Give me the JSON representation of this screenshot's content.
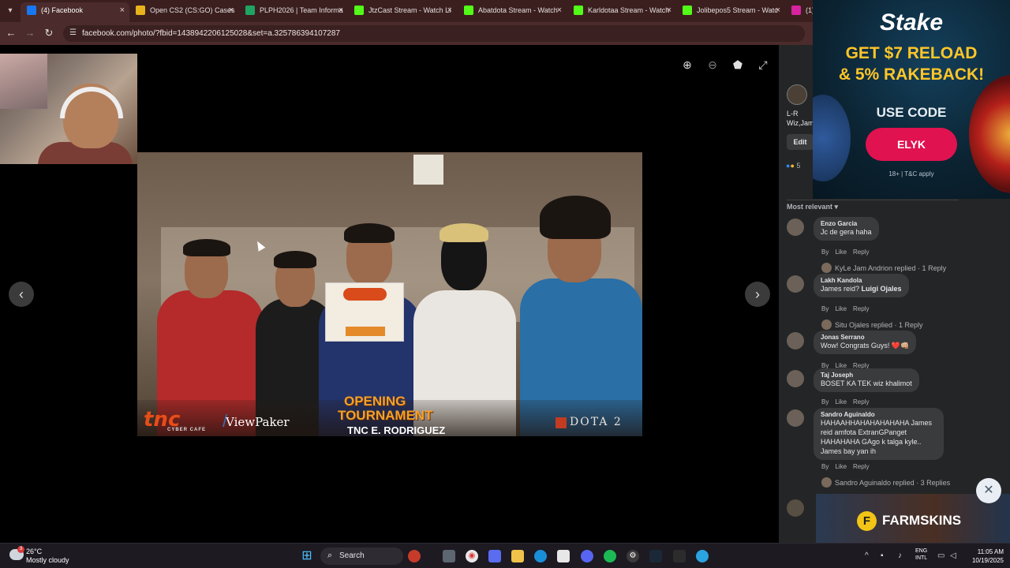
{
  "browser": {
    "tabs": [
      {
        "title": "(4) Facebook",
        "favicon": "facebook-icon",
        "color": "#1877f2",
        "active": true
      },
      {
        "title": "Open CS2 (CS:GO) Cases",
        "favicon": "case-icon",
        "color": "#e8b21a",
        "active": false
      },
      {
        "title": "PLPH2026 | Team Informa",
        "favicon": "sheets-icon",
        "color": "#1fa463",
        "active": false
      },
      {
        "title": "JtzCast Stream - Watch Li",
        "favicon": "kick-icon",
        "color": "#53fc18",
        "active": false
      },
      {
        "title": "Abatdota Stream - Watch",
        "favicon": "kick-icon",
        "color": "#53fc18",
        "active": false
      },
      {
        "title": "Karldotaa Stream - Watch",
        "favicon": "kick-icon",
        "color": "#53fc18",
        "active": false
      },
      {
        "title": "Jolibepos5 Stream - Watc",
        "favicon": "kick-icon",
        "color": "#53fc18",
        "active": false
      },
      {
        "title": "(1)",
        "favicon": "instagram-icon",
        "color": "#d6249f",
        "active": false
      }
    ],
    "url": "facebook.com/photo/?fbid=1438942206125028&set=a.325786394107287",
    "tab_close_glyph": "×"
  },
  "viewer": {
    "photo": {
      "card_brand": "tnc",
      "card_text": "CHAMPION",
      "footer": {
        "tnc_logo": "tnc",
        "tnc_sub": "CYBER CAFE",
        "viewpaker": "ViewPaker",
        "ot_line1": "OPENING",
        "ot_line2": "TOURNAMENT",
        "ot_line3": "TNC E. RODRIGUEZ",
        "dota": "DOTA 2"
      }
    }
  },
  "panel": {
    "caption": "L-R Wiz,Jam",
    "edit_label": "Edit",
    "reaction_count": "5",
    "sort_label": "Most relevant ▾",
    "comments": [
      {
        "name": "Enzo Garcia",
        "text": "Jc de gera haha",
        "actions": [
          "By",
          "Like",
          "Reply"
        ],
        "replies": "KyLe Jam Andrion replied · 1 Reply"
      },
      {
        "name": "Lakh Kandola",
        "text": "James reid? ",
        "mention": "Luigi Ojales",
        "actions": [
          "By",
          "Like",
          "Reply"
        ],
        "replies": "Situ Ojales replied · 1 Reply"
      },
      {
        "name": "Jonas Serrano",
        "text": "Wow! Congrats Guys! ❤️👊🏼",
        "actions": [
          "By",
          "Like",
          "Reply"
        ],
        "replies": ""
      },
      {
        "name": "Taj Joseph",
        "text": "BOSET KA TEK wiz khalimot",
        "actions": [
          "By",
          "Like",
          "Reply"
        ],
        "replies": ""
      },
      {
        "name": "Sandro Aguinaldo",
        "text": "HAHAAHHAHAHAHAHAHA James reid amfota ExtranGPanget HAHAHAHA GAgo k talga kyle.. James bay yan ih",
        "actions": [
          "By",
          "Like",
          "Reply"
        ],
        "replies": "Sandro Aguinaldo replied · 3 Replies"
      }
    ]
  },
  "ads": {
    "stake": {
      "logo": "Stake",
      "headline1": "GET $7 RELOAD",
      "headline2": "& 5% RAKEBACK!",
      "code_label": "USE CODE",
      "code": "ELYK",
      "tc": "18+ | T&C apply"
    },
    "farmskins": {
      "brand": "FARMSKINS",
      "icon_letter": "F"
    }
  },
  "taskbar": {
    "weather_temp": "26°C",
    "weather_desc": "Mostly cloudy",
    "weather_badge": "3",
    "search_label": "Search",
    "lang_line1": "ENG",
    "lang_line2": "INTL",
    "time": "11:05 AM",
    "date": "10/19/2025"
  }
}
